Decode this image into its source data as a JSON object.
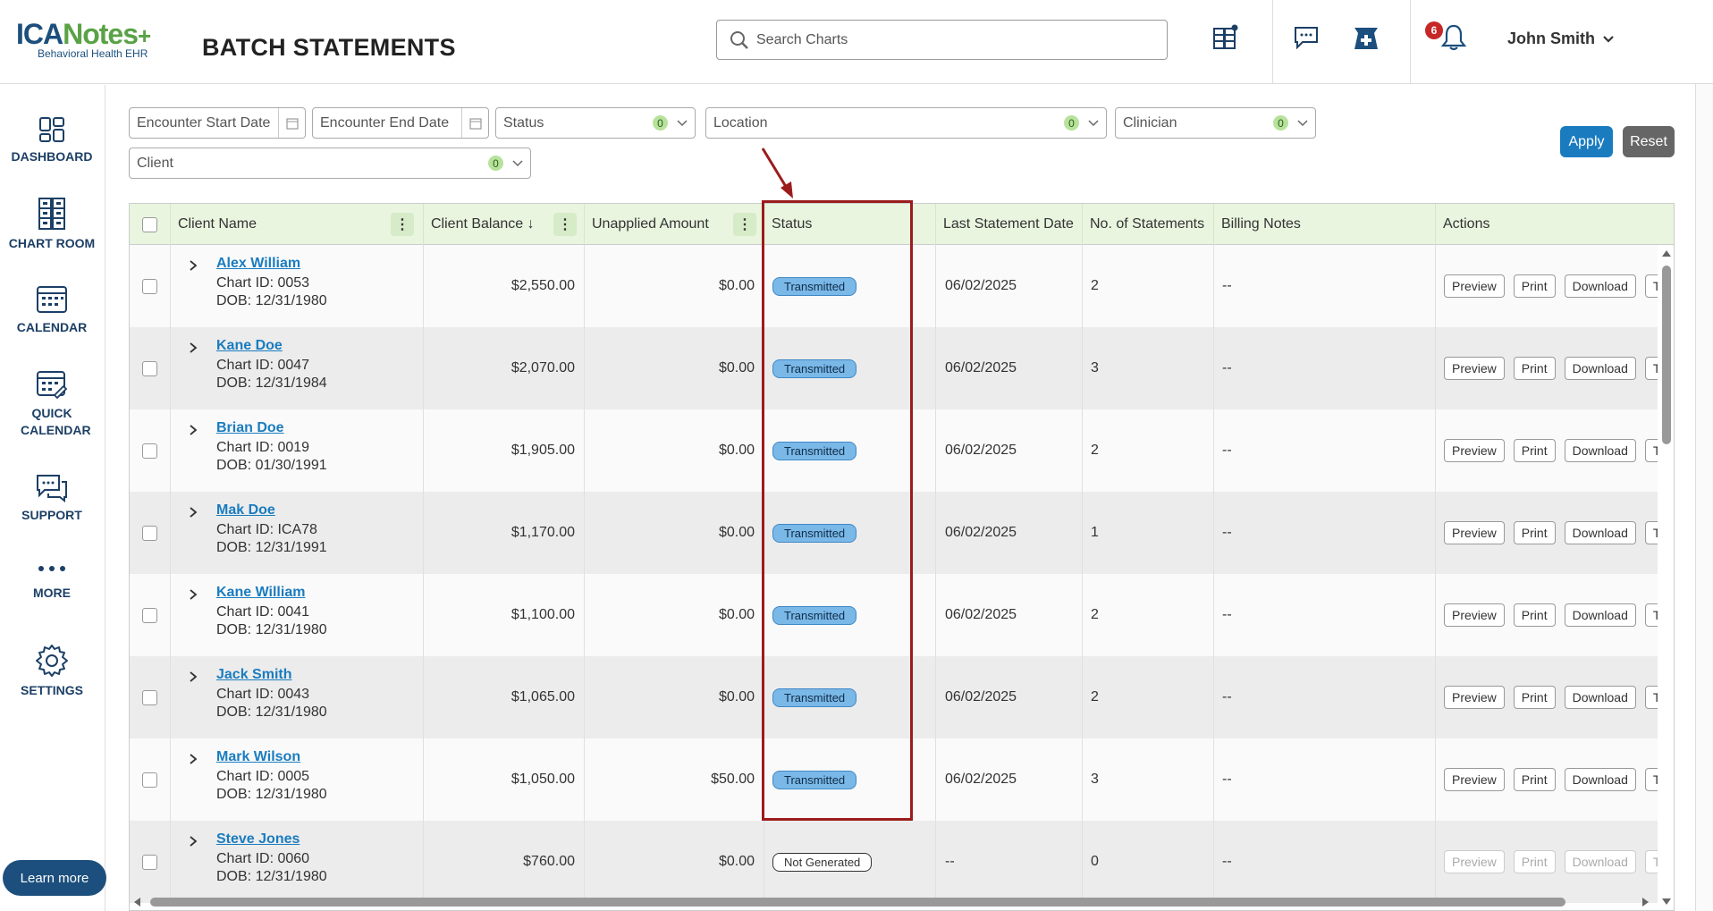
{
  "header": {
    "logo_brand_a": "ICA",
    "logo_brand_b": "Notes",
    "logo_sub": "Behavioral Health EHR",
    "title": "BATCH STATEMENTS",
    "search_placeholder": "Search Charts",
    "notifications_count": "6",
    "user_name": "John Smith"
  },
  "sidebar": {
    "items": [
      {
        "label": "DASHBOARD"
      },
      {
        "label": "CHART ROOM"
      },
      {
        "label": "CALENDAR"
      },
      {
        "label": "QUICK CALENDAR"
      },
      {
        "label": "SUPPORT"
      },
      {
        "label": "MORE"
      },
      {
        "label": "SETTINGS"
      }
    ],
    "learn_more": "Learn more"
  },
  "filters": {
    "encounter_start": "Encounter Start Date",
    "encounter_end": "Encounter End Date",
    "status": {
      "label": "Status",
      "count": "0"
    },
    "location": {
      "label": "Location",
      "count": "0"
    },
    "clinician": {
      "label": "Clinician",
      "count": "0"
    },
    "client": {
      "label": "Client",
      "count": "0"
    },
    "apply": "Apply",
    "reset": "Reset"
  },
  "table": {
    "headers": {
      "client_name": "Client Name",
      "client_balance": "Client Balance",
      "sort_indicator": "↓",
      "unapplied": "Unapplied Amount",
      "status": "Status",
      "last_statement": "Last Statement Date",
      "num_statements": "No. of Statements",
      "billing_notes": "Billing Notes",
      "actions": "Actions"
    },
    "actions": {
      "preview": "Preview",
      "print": "Print",
      "download": "Download",
      "more": "T"
    },
    "rows": [
      {
        "name": "Alex William",
        "chart": "Chart ID: 0053",
        "dob": "DOB: 12/31/1980",
        "balance": "$2,550.00",
        "unapplied": "$0.00",
        "status": "Transmitted",
        "last": "06/02/2025",
        "count": "2",
        "notes": "--"
      },
      {
        "name": "Kane Doe",
        "chart": "Chart ID: 0047",
        "dob": "DOB: 12/31/1984",
        "balance": "$2,070.00",
        "unapplied": "$0.00",
        "status": "Transmitted",
        "last": "06/02/2025",
        "count": "3",
        "notes": "--"
      },
      {
        "name": "Brian Doe",
        "chart": "Chart ID: 0019",
        "dob": "DOB: 01/30/1991",
        "balance": "$1,905.00",
        "unapplied": "$0.00",
        "status": "Transmitted",
        "last": "06/02/2025",
        "count": "2",
        "notes": "--"
      },
      {
        "name": "Mak Doe",
        "chart": "Chart ID: ICA78",
        "dob": "DOB: 12/31/1991",
        "balance": "$1,170.00",
        "unapplied": "$0.00",
        "status": "Transmitted",
        "last": "06/02/2025",
        "count": "1",
        "notes": "--"
      },
      {
        "name": "Kane William",
        "chart": "Chart ID: 0041",
        "dob": "DOB: 12/31/1980",
        "balance": "$1,100.00",
        "unapplied": "$0.00",
        "status": "Transmitted",
        "last": "06/02/2025",
        "count": "2",
        "notes": "--"
      },
      {
        "name": "Jack Smith",
        "chart": "Chart ID: 0043",
        "dob": "DOB: 12/31/1980",
        "balance": "$1,065.00",
        "unapplied": "$0.00",
        "status": "Transmitted",
        "last": "06/02/2025",
        "count": "2",
        "notes": "--"
      },
      {
        "name": "Mark Wilson",
        "chart": "Chart ID: 0005",
        "dob": "DOB: 12/31/1980",
        "balance": "$1,050.00",
        "unapplied": "$50.00",
        "status": "Transmitted",
        "last": "06/02/2025",
        "count": "3",
        "notes": "--"
      },
      {
        "name": "Steve Jones",
        "chart": "Chart ID: 0060",
        "dob": "DOB: 12/31/1980",
        "balance": "$760.00",
        "unapplied": "$0.00",
        "status": "Not Generated",
        "last": "--",
        "count": "0",
        "notes": "--"
      }
    ]
  },
  "colors": {
    "brand_blue": "#1c4f7d",
    "brand_green": "#5aa246",
    "highlight": "#9b1c1c",
    "header_bg": "#e9f5df"
  }
}
